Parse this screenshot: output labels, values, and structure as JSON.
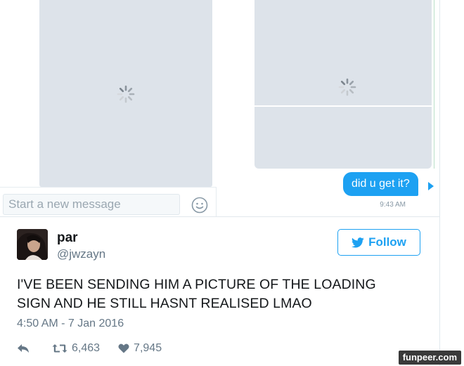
{
  "dm": {
    "message_text": "did u get it?",
    "message_time": "9:43 AM",
    "compose_placeholder": "Start a new message",
    "emoji_icon": "emoji-smile-icon",
    "loading_icon": "loading-spinner-icon",
    "accent_color": "#1da1f2",
    "image_placeholder_color": "#dde3ea"
  },
  "tweet": {
    "display_name": "par",
    "handle": "@jwzayn",
    "follow_label": "Follow",
    "text_line1": "I'VE BEEN SENDING HIM A PICTURE OF THE LOADING",
    "text_line2": "SIGN AND HE STILL HASNT REALISED LMAO",
    "timestamp": "4:50 AM - 7 Jan 2016",
    "retweet_count": "6,463",
    "like_count": "7,945",
    "icons": {
      "reply": "reply-icon",
      "retweet": "retweet-icon",
      "like": "heart-icon",
      "follow": "twitter-bird-icon"
    }
  },
  "watermark": {
    "text": "funpeer.com"
  }
}
